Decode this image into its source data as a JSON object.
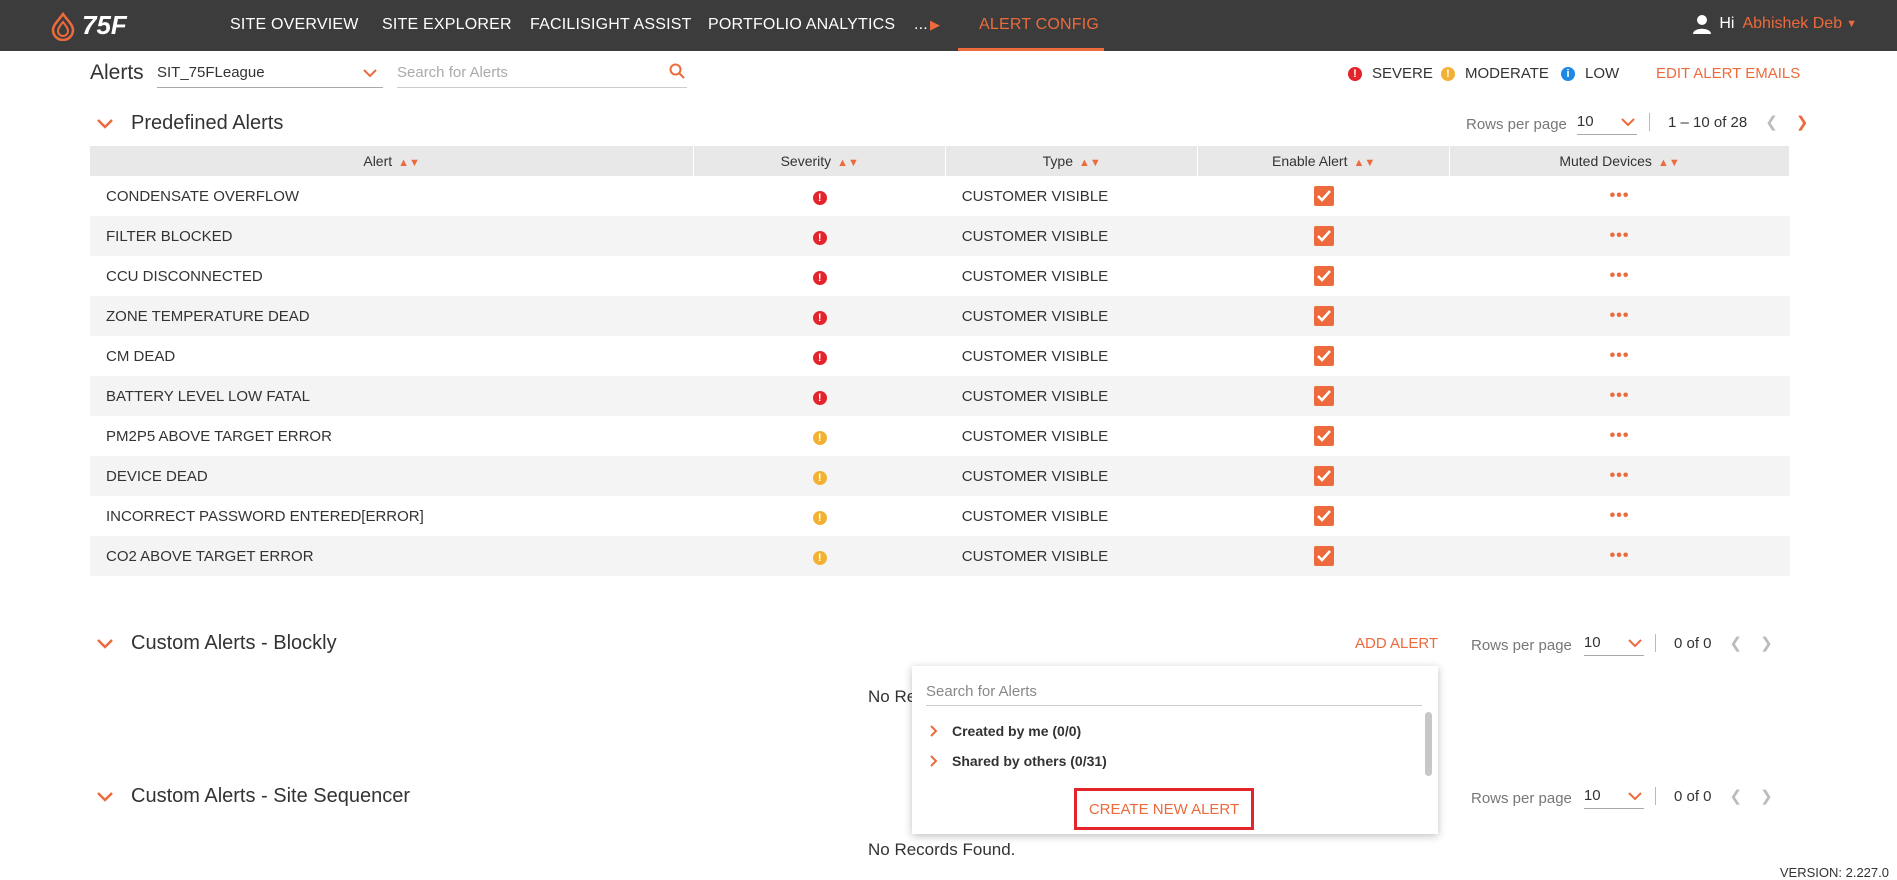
{
  "topbar": {
    "logo_text": "75F",
    "nav": [
      "SITE OVERVIEW",
      "SITE EXPLORER",
      "FACILISIGHT ASSIST",
      "PORTFOLIO ANALYTICS",
      "...",
      "ALERT CONFIG"
    ],
    "greeting": "Hi",
    "user_name": "Abhishek Deb"
  },
  "header": {
    "title": "Alerts",
    "site": "SIT_75FLeague",
    "search_placeholder": "Search for Alerts",
    "legend": {
      "severe": "SEVERE",
      "moderate": "MODERATE",
      "low": "LOW"
    },
    "edit_emails": "EDIT ALERT EMAILS"
  },
  "colors": {
    "accent": "#ec6a3c",
    "severe": "#e3242b",
    "moderate": "#f2b134",
    "low": "#1e88e5"
  },
  "predefined": {
    "title": "Predefined Alerts",
    "rows_per_page_label": "Rows per page",
    "rows_per_page": "10",
    "range": "1 – 10 of 28",
    "columns": [
      "Alert",
      "Severity",
      "Type",
      "Enable Alert",
      "Muted Devices"
    ],
    "rows": [
      {
        "alert": "CONDENSATE OVERFLOW",
        "severity": "severe",
        "type": "CUSTOMER VISIBLE"
      },
      {
        "alert": "FILTER BLOCKED",
        "severity": "severe",
        "type": "CUSTOMER VISIBLE"
      },
      {
        "alert": "CCU DISCONNECTED",
        "severity": "severe",
        "type": "CUSTOMER VISIBLE"
      },
      {
        "alert": "ZONE TEMPERATURE DEAD",
        "severity": "severe",
        "type": "CUSTOMER VISIBLE"
      },
      {
        "alert": "CM DEAD",
        "severity": "severe",
        "type": "CUSTOMER VISIBLE"
      },
      {
        "alert": "BATTERY LEVEL LOW FATAL",
        "severity": "severe",
        "type": "CUSTOMER VISIBLE"
      },
      {
        "alert": "PM2P5 ABOVE TARGET ERROR",
        "severity": "moderate",
        "type": "CUSTOMER VISIBLE"
      },
      {
        "alert": "DEVICE DEAD",
        "severity": "moderate",
        "type": "CUSTOMER VISIBLE"
      },
      {
        "alert": "INCORRECT PASSWORD ENTERED[ERROR]",
        "severity": "moderate",
        "type": "CUSTOMER VISIBLE"
      },
      {
        "alert": "CO2 ABOVE TARGET ERROR",
        "severity": "moderate",
        "type": "CUSTOMER VISIBLE"
      }
    ]
  },
  "blockly": {
    "title": "Custom Alerts - Blockly",
    "add_alert": "ADD ALERT",
    "rows_per_page_label": "Rows per page",
    "rows_per_page": "10",
    "range": "0 of 0",
    "no_records": "No Re"
  },
  "sequencer": {
    "title": "Custom Alerts - Site Sequencer",
    "rows_per_page_label": "Rows per page",
    "rows_per_page": "10",
    "range": "0 of 0",
    "no_records": "No Records Found."
  },
  "dropdown": {
    "search_placeholder": "Search for Alerts",
    "groups": [
      "Created by me (0/0)",
      "Shared by others (0/31)"
    ],
    "create_label": "CREATE NEW ALERT"
  },
  "version": "VERSION: 2.227.0"
}
